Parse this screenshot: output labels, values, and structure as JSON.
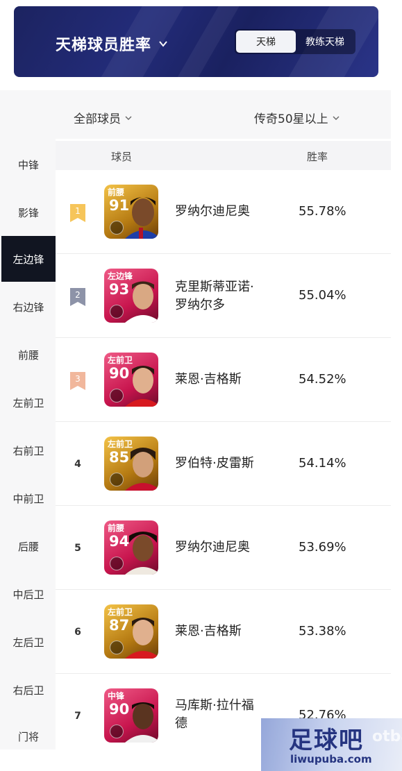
{
  "header": {
    "title": "天梯球员胜率",
    "tabs": [
      {
        "label": "天梯",
        "active": true
      },
      {
        "label": "教练天梯",
        "active": false
      }
    ]
  },
  "filters": {
    "player_filter": "全部球员",
    "tier_filter": "传奇50星以上"
  },
  "sidebar": {
    "items": [
      {
        "label": "中锋",
        "active": false
      },
      {
        "label": "影锋",
        "active": false
      },
      {
        "label": "左边锋",
        "active": true
      },
      {
        "label": "右边锋",
        "active": false
      },
      {
        "label": "前腰",
        "active": false
      },
      {
        "label": "左前卫",
        "active": false
      },
      {
        "label": "右前卫",
        "active": false
      },
      {
        "label": "中前卫",
        "active": false
      },
      {
        "label": "后腰",
        "active": false
      },
      {
        "label": "中后卫",
        "active": false
      },
      {
        "label": "左后卫",
        "active": false
      },
      {
        "label": "右后卫",
        "active": false
      },
      {
        "label": "门将",
        "active": false
      }
    ]
  },
  "table": {
    "columns": {
      "player": "球员",
      "win_rate": "胜率"
    },
    "rows": [
      {
        "rank": "1",
        "position": "前腰",
        "rating": "91",
        "name_line1": "罗纳尔迪尼奥",
        "name_line2": "",
        "win_rate": "55.78%",
        "card_color": "gold",
        "badge": "gold"
      },
      {
        "rank": "2",
        "position": "左边锋",
        "rating": "93",
        "name_line1": "克里斯蒂亚诺·",
        "name_line2": "罗纳尔多",
        "win_rate": "55.04%",
        "card_color": "pink",
        "badge": "silver"
      },
      {
        "rank": "3",
        "position": "左前卫",
        "rating": "90",
        "name_line1": "莱恩·吉格斯",
        "name_line2": "",
        "win_rate": "54.52%",
        "card_color": "pink",
        "badge": "bronze"
      },
      {
        "rank": "4",
        "position": "左前卫",
        "rating": "85",
        "name_line1": "罗伯特·皮雷斯",
        "name_line2": "",
        "win_rate": "54.14%",
        "card_color": "gold",
        "badge": "none"
      },
      {
        "rank": "5",
        "position": "前腰",
        "rating": "94",
        "name_line1": "罗纳尔迪尼奥",
        "name_line2": "",
        "win_rate": "53.69%",
        "card_color": "pink",
        "badge": "none"
      },
      {
        "rank": "6",
        "position": "左前卫",
        "rating": "87",
        "name_line1": "莱恩·吉格斯",
        "name_line2": "",
        "win_rate": "53.38%",
        "card_color": "gold",
        "badge": "none"
      },
      {
        "rank": "7",
        "position": "中锋",
        "rating": "90",
        "name_line1": "马库斯·拉什福",
        "name_line2": "德",
        "win_rate": "52.76%",
        "card_color": "pink",
        "badge": "none"
      }
    ]
  },
  "watermark": {
    "title": "足球吧",
    "side_text": "otba",
    "url": "liwupuba.com"
  },
  "colors": {
    "banner": "#1f2766",
    "sidebar_active": "#111521",
    "gold_badge": "#f6c55a",
    "silver_badge": "#8d93a8",
    "bronze_badge": "#f1b79c",
    "gold_card": "#c9921c",
    "pink_card": "#d61c5c"
  }
}
